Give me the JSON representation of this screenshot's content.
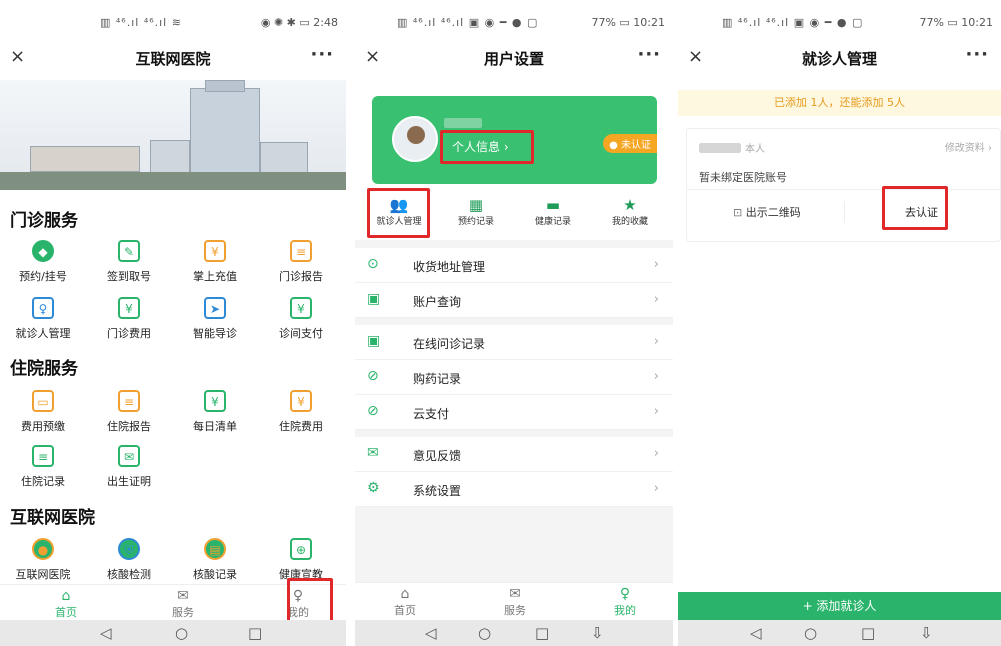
{
  "accent_color": "#2ab46b",
  "highlight_color": "#e0282b",
  "panel1": {
    "status_left": "▥ ⁴⁶.ıl ⁴⁶.ıl ≋",
    "status_right": "◉ ✺ ✱ ▭ 2:48",
    "title": "互联网医院",
    "close": "×",
    "more": "···",
    "outpatient_title": "门诊服务",
    "outpatient_items": [
      {
        "label": "预约/挂号",
        "icon": "appointment-icon",
        "glyph": "◆"
      },
      {
        "label": "签到取号",
        "icon": "sign-in-icon",
        "glyph": "✎"
      },
      {
        "label": "掌上充值",
        "icon": "recharge-icon",
        "glyph": "¥"
      },
      {
        "label": "门诊报告",
        "icon": "report-icon",
        "glyph": "≡"
      },
      {
        "label": "就诊人管理",
        "icon": "patient-icon",
        "glyph": "♀"
      },
      {
        "label": "门诊费用",
        "icon": "fee-icon",
        "glyph": "¥"
      },
      {
        "label": "智能导诊",
        "icon": "guide-icon",
        "glyph": "➤"
      },
      {
        "label": "诊间支付",
        "icon": "pay-icon",
        "glyph": "¥"
      }
    ],
    "inpatient_title": "住院服务",
    "inpatient_items": [
      {
        "label": "费用预缴",
        "icon": "prepay-icon",
        "glyph": "▭"
      },
      {
        "label": "住院报告",
        "icon": "inpatient-report-icon",
        "glyph": "≡"
      },
      {
        "label": "每日清单",
        "icon": "daily-list-icon",
        "glyph": "¥"
      },
      {
        "label": "住院费用",
        "icon": "inpatient-fee-icon",
        "glyph": "¥"
      },
      {
        "label": "住院记录",
        "icon": "inpatient-record-icon",
        "glyph": "≡"
      },
      {
        "label": "出生证明",
        "icon": "birth-certificate-icon",
        "glyph": "✉"
      }
    ],
    "internet_title": "互联网医院",
    "internet_items": [
      {
        "label": "互联网医院",
        "icon": "internet-hospital-icon",
        "glyph": "●"
      },
      {
        "label": "核酸检测",
        "icon": "nucleic-test-icon",
        "glyph": "⛨"
      },
      {
        "label": "核酸记录",
        "icon": "nucleic-record-icon",
        "glyph": "▤"
      },
      {
        "label": "健康宣教",
        "icon": "health-education-icon",
        "glyph": "⊕"
      }
    ],
    "tabs": [
      {
        "label": "首页",
        "glyph": "⌂"
      },
      {
        "label": "服务",
        "glyph": "✉"
      },
      {
        "label": "我的",
        "glyph": "♀"
      }
    ],
    "nav": [
      "◁",
      "○",
      "□"
    ]
  },
  "panel2": {
    "status_left": "▥ ⁴⁶.ıl ⁴⁶.ıl ▣ ◉ ━ ● ▢",
    "status_right": "77% ▭ 10:21",
    "title": "用户设置",
    "close": "×",
    "more": "···",
    "personal_info_btn": "个人信息 ›",
    "auth_badge": "● 未认证",
    "shortcuts": [
      {
        "label": "就诊人管理",
        "glyph": "👥",
        "icon": "patients-icon"
      },
      {
        "label": "预约记录",
        "glyph": "▦",
        "icon": "calendar-icon"
      },
      {
        "label": "健康记录",
        "glyph": "▬",
        "icon": "folder-icon"
      },
      {
        "label": "我的收藏",
        "glyph": "★",
        "icon": "star-icon"
      }
    ],
    "menu_group1": [
      {
        "label": "收货地址管理",
        "glyph": "⊙",
        "icon": "address-icon"
      },
      {
        "label": "账户查询",
        "glyph": "▣",
        "icon": "account-icon"
      }
    ],
    "menu_group2": [
      {
        "label": "在线问诊记录",
        "glyph": "▣",
        "icon": "consult-icon"
      },
      {
        "label": "购药记录",
        "glyph": "⊘",
        "icon": "medicine-icon"
      },
      {
        "label": "云支付",
        "glyph": "⊘",
        "icon": "cloud-pay-icon"
      }
    ],
    "menu_group3": [
      {
        "label": "意见反馈",
        "glyph": "✉",
        "icon": "feedback-icon"
      },
      {
        "label": "系统设置",
        "glyph": "⚙",
        "icon": "settings-icon"
      }
    ],
    "arrow": "›",
    "tabs": [
      {
        "label": "首页",
        "glyph": "⌂"
      },
      {
        "label": "服务",
        "glyph": "✉"
      },
      {
        "label": "我的",
        "glyph": "♀"
      }
    ],
    "nav": [
      "◁",
      "○",
      "□",
      "⇩"
    ]
  },
  "panel3": {
    "status_left": "▥ ⁴⁶.ıl ⁴⁶.ıl ▣ ◉ ━ ● ▢",
    "status_right": "77% ▭ 10:21",
    "title": "就诊人管理",
    "close": "×",
    "more": "···",
    "notice": "已添加 1人，还能添加 5人",
    "self_tag": "本人",
    "edit_link": "修改资料 ›",
    "unbound_text": "暂未绑定医院账号",
    "qr_btn": "出示二维码",
    "verify_btn": "去认证",
    "add_btn": "+ 添加就诊人",
    "nav": [
      "◁",
      "○",
      "□",
      "⇩"
    ]
  }
}
